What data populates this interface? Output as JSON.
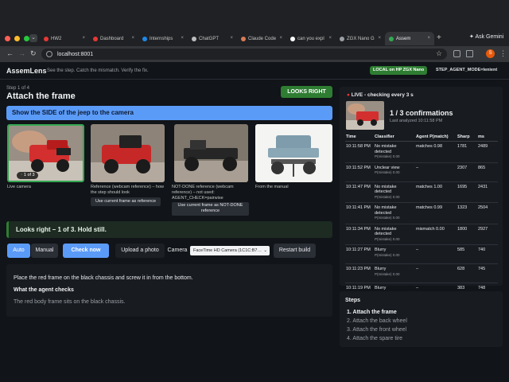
{
  "browser": {
    "tabs": [
      {
        "label": "HW2",
        "color": "#e53935"
      },
      {
        "label": "Dashboard",
        "color": "#e53935"
      },
      {
        "label": "Internships",
        "color": "#1e88e5"
      },
      {
        "label": "ChatGPT",
        "color": "#bdbdbd"
      },
      {
        "label": "Claude Code",
        "color": "#d87a56"
      },
      {
        "label": "can you expl",
        "color": "#ffffff"
      },
      {
        "label": "ZGX Nano G",
        "color": "#9aa0a6"
      },
      {
        "label": "Assem",
        "color": "#34a853"
      }
    ],
    "new_tab": "+",
    "ask_gemini": "Ask Gemini",
    "url": "localhost:8001",
    "avatar_letter": "S"
  },
  "app": {
    "name": "AssemLens",
    "tagline": "See the step. Catch the mismatch. Verify the fix.",
    "local_badge": "LOCAL on HP ZGX Nano",
    "mode": "STEP_AGENT_MODE=lenient"
  },
  "step": {
    "counter": "Step 1 of 4",
    "title": "Attach the frame",
    "verdict_button": "LOOKS RIGHT",
    "instruction": "Show the SIDE of the jeep to the camera"
  },
  "thumbs": {
    "live_badge": "1 of 3",
    "live_caption": "Live camera",
    "reference_caption": "Reference (webcam reference) – how the step should look",
    "reference_button": "Use current frame as reference",
    "notdone_caption": "NOT-DONE reference (webcam reference) – not used: AGENT_CHECK=pairwise",
    "notdone_button": "Use current frame as NOT-DONE reference",
    "manual_caption": "From the manual"
  },
  "status_bar": "Looks right – 1 of 3. Hold still.",
  "controls": {
    "auto": "Auto",
    "manual": "Manual",
    "check_now": "Check now",
    "upload": "Upload a photo",
    "camera_label": "Camera",
    "camera_value": "FaceTime HD Camera (1C1C:B7…",
    "restart": "Restart build"
  },
  "description": {
    "text": "Place the red frame on the black chassis and screw it in from the bottom.",
    "check_heading": "What the agent checks",
    "check_text": "The red body frame sits on the black chassis."
  },
  "live_panel": {
    "title": "LIVE - checking every 3 s",
    "confirmations": "1 / 3 confirmations",
    "last_analyzed": "Last analyzed 10:11:58 PM",
    "columns": [
      "Time",
      "Classifier",
      "Agent P(match)",
      "Sharp",
      "ms"
    ],
    "rows": [
      {
        "time": "10:11:58 PM",
        "classifier": "No mistake detected",
        "sub": "P(mistake) 0.00",
        "agent": "matches 0.98",
        "sharp": "1781",
        "ms": "2489"
      },
      {
        "time": "10:11:52 PM",
        "classifier": "Unclear view",
        "sub": "P(mistake) 0.00",
        "agent": "–",
        "sharp": "2307",
        "ms": "865"
      },
      {
        "time": "10:11:47 PM",
        "classifier": "No mistake detected",
        "sub": "P(mistake) 0.00",
        "agent": "matches 1.00",
        "sharp": "1695",
        "ms": "2431"
      },
      {
        "time": "10:11:41 PM",
        "classifier": "No mistake detected",
        "sub": "P(mistake) 0.00",
        "agent": "matches 0.99",
        "sharp": "1323",
        "ms": "2504"
      },
      {
        "time": "10:11:34 PM",
        "classifier": "No mistake detected",
        "sub": "P(mistake) 0.00",
        "agent": "mismatch 0.00",
        "sharp": "1800",
        "ms": "2927"
      },
      {
        "time": "10:11:27 PM",
        "classifier": "Blurry",
        "sub": "P(mistake) 0.00",
        "agent": "–",
        "sharp": "585",
        "ms": "740"
      },
      {
        "time": "10:11:23 PM",
        "classifier": "Blurry",
        "sub": "P(mistake) 0.00",
        "agent": "–",
        "sharp": "628",
        "ms": "745"
      },
      {
        "time": "10:11:19 PM",
        "classifier": "Blurry",
        "sub": "P(mistake) 0.00",
        "agent": "–",
        "sharp": "383",
        "ms": "748"
      }
    ]
  },
  "steps_panel": {
    "title": "Steps",
    "items": [
      "1. Attach the frame",
      "2. Attach the back wheel",
      "3. Attach the front wheel",
      "4. Attach the spare tire"
    ]
  },
  "colors": {
    "accent_blue": "#5b9bf8",
    "success_green": "#2e7d32"
  }
}
